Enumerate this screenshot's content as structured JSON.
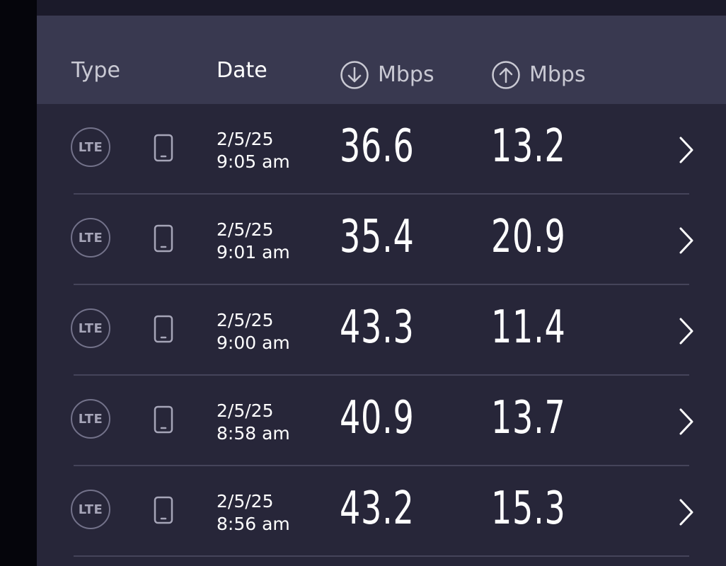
{
  "header": {
    "type_label": "Type",
    "date_label": "Date",
    "download_label": "Mbps",
    "upload_label": "Mbps"
  },
  "rows": [
    {
      "network": "LTE",
      "device": "phone-icon",
      "date": "2/5/25",
      "time": "9:05 am",
      "download": "36.6",
      "upload": "13.2"
    },
    {
      "network": "LTE",
      "device": "phone-icon",
      "date": "2/5/25",
      "time": "9:01 am",
      "download": "35.4",
      "upload": "20.9"
    },
    {
      "network": "LTE",
      "device": "phone-icon",
      "date": "2/5/25",
      "time": "9:00 am",
      "download": "43.3",
      "upload": "11.4"
    },
    {
      "network": "LTE",
      "device": "phone-icon",
      "date": "2/5/25",
      "time": "8:58 am",
      "download": "40.9",
      "upload": "13.7"
    },
    {
      "network": "LTE",
      "device": "phone-icon",
      "date": "2/5/25",
      "time": "8:56 am",
      "download": "43.2",
      "upload": "15.3"
    }
  ],
  "colors": {
    "background": "#272639",
    "header": "#393950",
    "divider": "#45445a",
    "text": "#ffffff"
  }
}
